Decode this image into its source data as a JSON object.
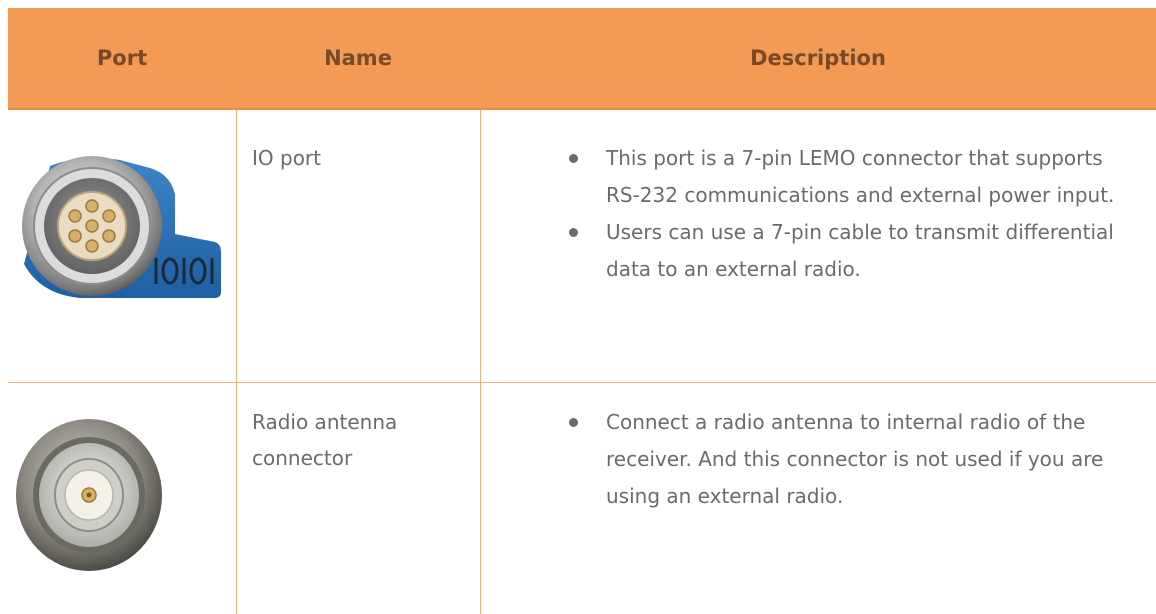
{
  "table": {
    "headers": {
      "port": "Port",
      "name": "Name",
      "description": "Description"
    },
    "rows": [
      {
        "port_icon": "lemo-7pin-connector-icon",
        "name": "IO port",
        "description": [
          "This port is a 7-pin LEMO connector that supports RS-232 communications and external power input.",
          "Users can use a 7-pin cable to transmit differential data to an external radio."
        ],
        "port_marking": "IOIOI"
      },
      {
        "port_icon": "tnc-antenna-connector-icon",
        "name": "Radio antenna connector",
        "description": [
          "Connect a radio antenna to internal radio of the receiver. And this connector is not used if you are using an external radio."
        ]
      }
    ]
  },
  "colors": {
    "header_bg": "#f39b55",
    "header_text": "#7a4a26",
    "border": "#f0b27c",
    "body_text": "#6b6b6b"
  }
}
